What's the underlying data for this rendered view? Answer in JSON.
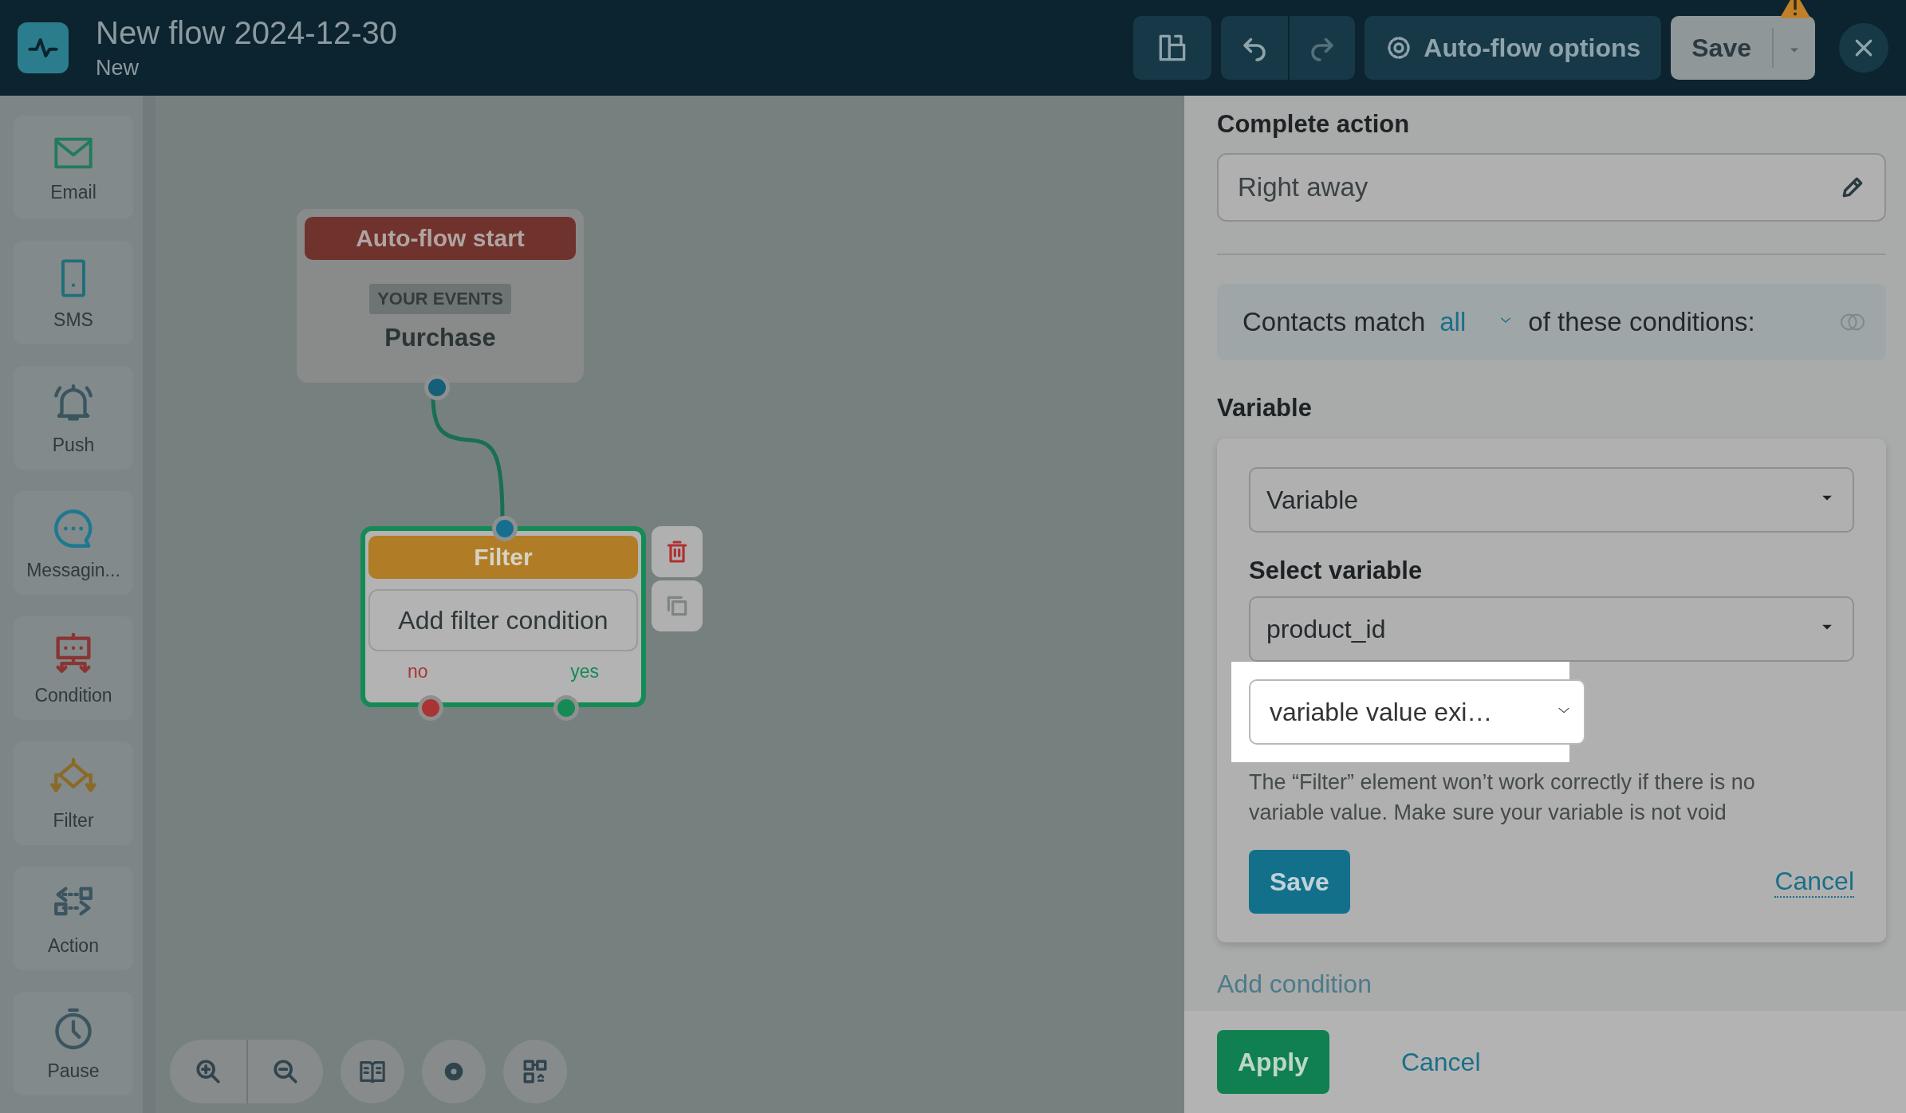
{
  "header": {
    "title": "New flow 2024-12-30",
    "subtitle": "New",
    "options_button": "Auto-flow options",
    "save_button": "Save"
  },
  "sidebar": {
    "items": [
      {
        "label": "Email"
      },
      {
        "label": "SMS"
      },
      {
        "label": "Push"
      },
      {
        "label": "Messagin..."
      },
      {
        "label": "Condition"
      },
      {
        "label": "Filter"
      },
      {
        "label": "Action"
      },
      {
        "label": "Pause"
      }
    ]
  },
  "canvas": {
    "start_node": {
      "header": "Auto-flow start",
      "tag": "YOUR EVENTS",
      "event": "Purchase"
    },
    "filter_node": {
      "header": "Filter",
      "button": "Add filter condition",
      "outputs": [
        {
          "label": "no",
          "color": "#a83434"
        },
        {
          "label": "yes",
          "color": "#158a55"
        }
      ]
    }
  },
  "panel": {
    "complete_action": {
      "label": "Complete action",
      "value": "Right away"
    },
    "match": {
      "prefix": "Contacts match",
      "value": "all",
      "suffix": "of these conditions:"
    },
    "variable": {
      "heading": "Variable",
      "type_select": "Variable",
      "select_label": "Select variable",
      "variable_select": "product_id",
      "operator_select": "variable value exi…",
      "hint": "The “Filter” element won’t work correctly if there is no variable value. Make sure your variable is not void",
      "save": "Save",
      "cancel": "Cancel"
    },
    "add_condition": "Add condition",
    "footer": {
      "apply": "Apply",
      "cancel": "Cancel"
    }
  }
}
